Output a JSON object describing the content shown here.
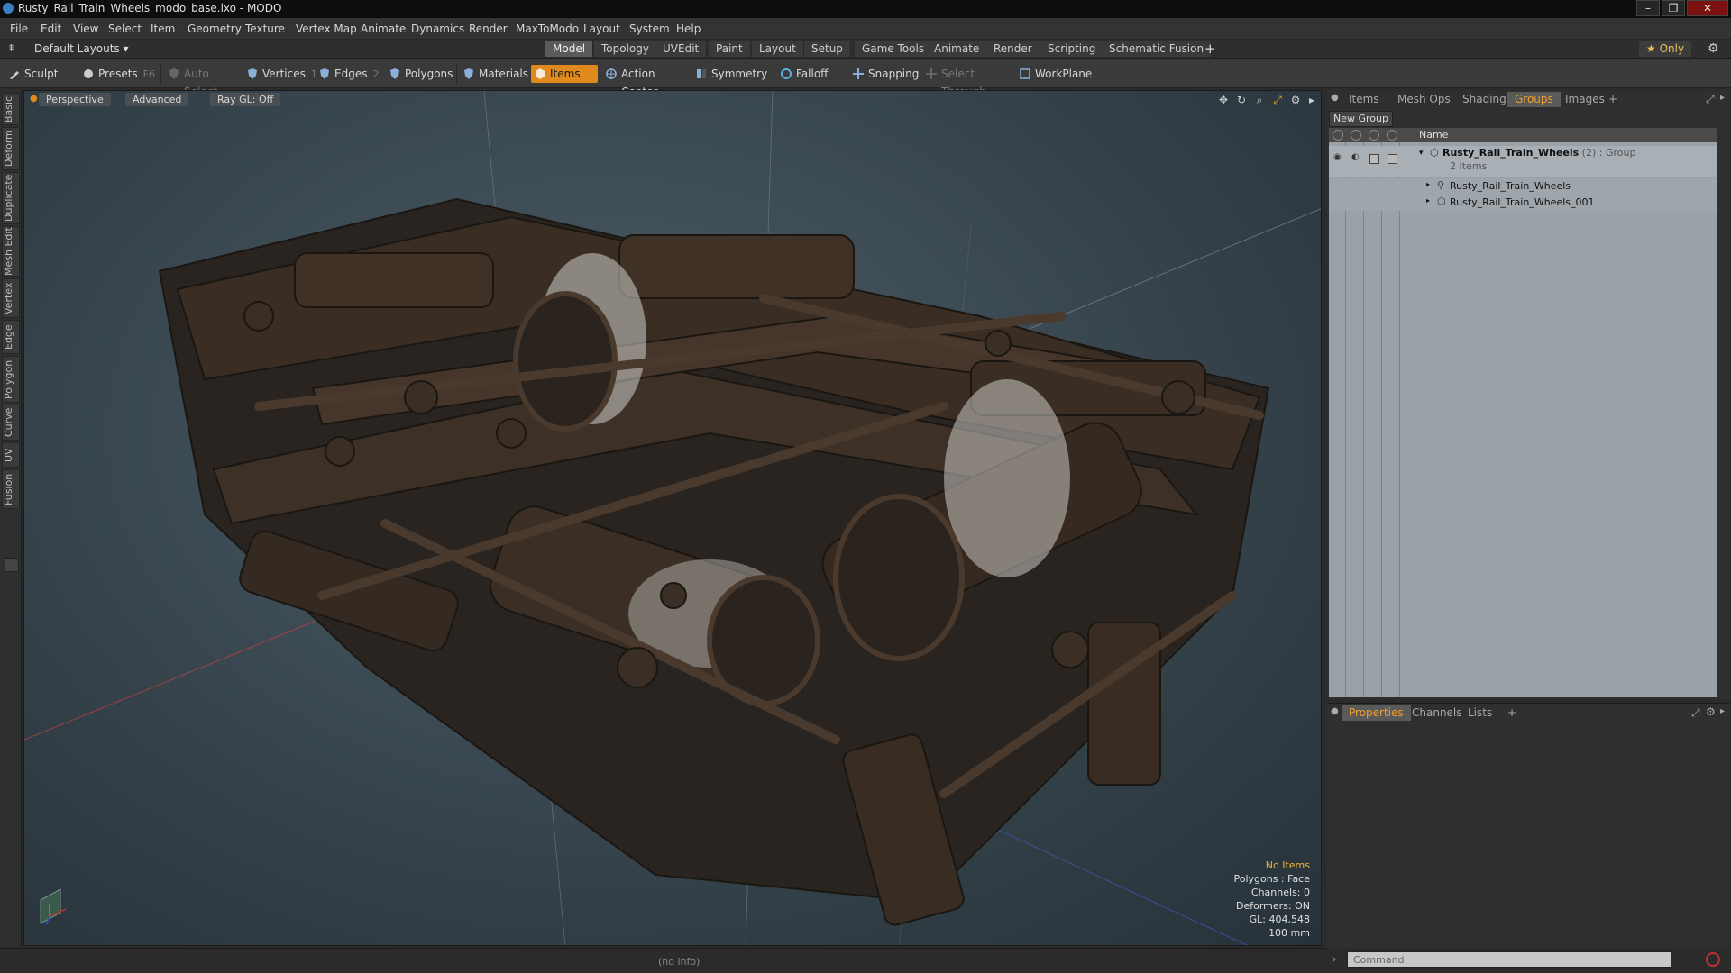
{
  "window": {
    "title": "Rusty_Rail_Train_Wheels_modo_base.lxo - MODO",
    "controls": [
      "–",
      "❐",
      "✕"
    ]
  },
  "menu": [
    "File",
    "Edit",
    "View",
    "Select",
    "Item",
    "Geometry",
    "Texture",
    "Vertex Map",
    "Animate",
    "Dynamics",
    "Render",
    "MaxToModo",
    "Layout",
    "System",
    "Help"
  ],
  "layout_bar": {
    "layouts_label": "Default Layouts ▾",
    "tabs": [
      "Model",
      "Topology",
      "UVEdit",
      "Paint",
      "Layout",
      "Setup",
      "Game Tools",
      "Animate",
      "Render",
      "Scripting",
      "Schematic Fusion"
    ],
    "active_tab": "Model",
    "add": "+",
    "only_label": "★ Only",
    "gear": "⚙"
  },
  "toolbar": {
    "sculpt": "Sculpt",
    "presets": "Presets",
    "presets_key": "F6",
    "auto_select": "Auto Select",
    "vertices": "Vertices",
    "vertices_num": "1",
    "edges": "Edges",
    "edges_num": "2",
    "polygons": "Polygons",
    "materials": "Materials",
    "items": "Items",
    "action_center": "Action Center",
    "symmetry": "Symmetry",
    "falloff": "Falloff",
    "snapping": "Snapping",
    "select_through": "Select Through",
    "workplane": "WorkPlane"
  },
  "left_tabs": [
    "Basic",
    "Deform",
    "Duplicate",
    "Mesh Edit",
    "Vertex",
    "Edge",
    "Polygon",
    "Curve",
    "UV",
    "Fusion"
  ],
  "viewport": {
    "view_mode": "Perspective",
    "advanced": "Advanced",
    "ray_gl": "Ray GL: Off",
    "info": {
      "selection": "No Items",
      "polygons": "Polygons : Face",
      "channels": "Channels: 0",
      "deformers": "Deformers: ON",
      "gl": "GL: 404,548",
      "scale": "100 mm"
    }
  },
  "status": {
    "info": "(no info)"
  },
  "right_top": {
    "tabs": [
      "Items",
      "Mesh Ops",
      "Shading",
      "Groups",
      "Images"
    ],
    "active_tab": "Groups",
    "add": "+",
    "new_group": "New Group",
    "column_name": "Name",
    "group": {
      "name": "Rusty_Rail_Train_Wheels",
      "count": "(2)",
      "kind": ": Group",
      "items_line": "2 Items",
      "children": [
        "Rusty_Rail_Train_Wheels",
        "Rusty_Rail_Train_Wheels_001"
      ]
    }
  },
  "right_bottom": {
    "tabs": [
      "Properties",
      "Channels",
      "Lists"
    ],
    "active_tab": "Properties",
    "add": "+"
  },
  "command": {
    "placeholder": "Command"
  },
  "colors": {
    "accent": "#e08a1e",
    "active_tab_text": "#f0a030",
    "list_bg": "#9aa1a7"
  }
}
